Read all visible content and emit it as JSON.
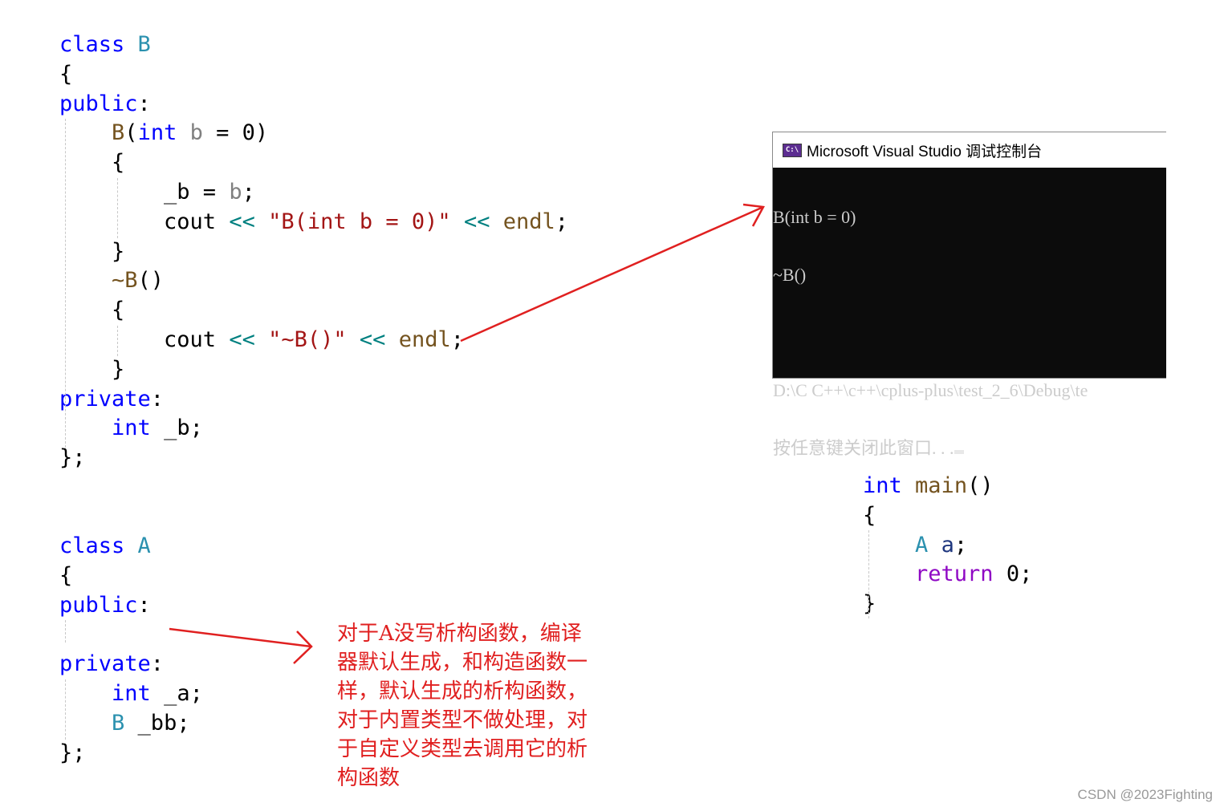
{
  "class_b": {
    "lines": [
      {
        "segments": [
          {
            "t": "class",
            "c": "kw"
          },
          {
            "t": " "
          },
          {
            "t": "B",
            "c": "ty"
          }
        ]
      },
      {
        "segments": [
          {
            "t": "{"
          }
        ]
      },
      {
        "segments": [
          {
            "t": "public",
            "c": "kw"
          },
          {
            "t": ":"
          }
        ]
      },
      {
        "segments": [
          {
            "t": "    "
          },
          {
            "t": "B",
            "c": "fn"
          },
          {
            "t": "("
          },
          {
            "t": "int",
            "c": "kw"
          },
          {
            "t": " "
          },
          {
            "t": "b",
            "c": "pm"
          },
          {
            "t": " = 0)"
          }
        ]
      },
      {
        "segments": [
          {
            "t": "    {"
          }
        ]
      },
      {
        "segments": [
          {
            "t": "        _b = "
          },
          {
            "t": "b",
            "c": "pm"
          },
          {
            "t": ";"
          }
        ]
      },
      {
        "segments": [
          {
            "t": "        cout "
          },
          {
            "t": "<<",
            "c": "op"
          },
          {
            "t": " "
          },
          {
            "t": "\"B(int b = 0)\"",
            "c": "st"
          },
          {
            "t": " "
          },
          {
            "t": "<<",
            "c": "op"
          },
          {
            "t": " "
          },
          {
            "t": "endl",
            "c": "fn"
          },
          {
            "t": ";"
          }
        ]
      },
      {
        "segments": [
          {
            "t": "    }"
          }
        ]
      },
      {
        "segments": [
          {
            "t": "    "
          },
          {
            "t": "~B",
            "c": "fn"
          },
          {
            "t": "()"
          }
        ]
      },
      {
        "segments": [
          {
            "t": "    {"
          }
        ]
      },
      {
        "segments": [
          {
            "t": "        cout "
          },
          {
            "t": "<<",
            "c": "op"
          },
          {
            "t": " "
          },
          {
            "t": "\"~B()\"",
            "c": "st"
          },
          {
            "t": " "
          },
          {
            "t": "<<",
            "c": "op"
          },
          {
            "t": " "
          },
          {
            "t": "endl",
            "c": "fn"
          },
          {
            "t": ";"
          }
        ]
      },
      {
        "segments": [
          {
            "t": "    }"
          }
        ]
      },
      {
        "segments": [
          {
            "t": "private",
            "c": "kw"
          },
          {
            "t": ":"
          }
        ]
      },
      {
        "segments": [
          {
            "t": "    "
          },
          {
            "t": "int",
            "c": "kw"
          },
          {
            "t": " _b;"
          }
        ]
      },
      {
        "segments": [
          {
            "t": "};"
          }
        ]
      }
    ]
  },
  "class_a": {
    "lines": [
      {
        "segments": [
          {
            "t": "class",
            "c": "kw"
          },
          {
            "t": " "
          },
          {
            "t": "A",
            "c": "ty"
          }
        ]
      },
      {
        "segments": [
          {
            "t": "{"
          }
        ]
      },
      {
        "segments": [
          {
            "t": "public",
            "c": "kw"
          },
          {
            "t": ":"
          }
        ]
      },
      {
        "segments": [
          {
            "t": ""
          }
        ]
      },
      {
        "segments": [
          {
            "t": "private",
            "c": "kw"
          },
          {
            "t": ":"
          }
        ]
      },
      {
        "segments": [
          {
            "t": "    "
          },
          {
            "t": "int",
            "c": "kw"
          },
          {
            "t": " _a;"
          }
        ]
      },
      {
        "segments": [
          {
            "t": "    "
          },
          {
            "t": "B",
            "c": "ty"
          },
          {
            "t": " _bb;"
          }
        ]
      },
      {
        "segments": [
          {
            "t": "};"
          }
        ]
      }
    ]
  },
  "main_func": {
    "lines": [
      {
        "segments": [
          {
            "t": "int",
            "c": "kw"
          },
          {
            "t": " "
          },
          {
            "t": "main",
            "c": "fn"
          },
          {
            "t": "()"
          }
        ]
      },
      {
        "segments": [
          {
            "t": "{"
          }
        ]
      },
      {
        "segments": [
          {
            "t": "    "
          },
          {
            "t": "A",
            "c": "ty"
          },
          {
            "t": " "
          },
          {
            "t": "a",
            "c": "var"
          },
          {
            "t": ";"
          }
        ]
      },
      {
        "segments": [
          {
            "t": "    "
          },
          {
            "t": "return",
            "c": "ret"
          },
          {
            "t": " 0;"
          }
        ]
      },
      {
        "segments": [
          {
            "t": "}"
          }
        ]
      }
    ]
  },
  "console": {
    "icon_label": "C:\\",
    "title": "Microsoft Visual Studio 调试控制台",
    "output_lines": [
      "B(int b = 0)",
      "~B()",
      "",
      "D:\\C C++\\c++\\cplus-plus\\test_2_6\\Debug\\te",
      "按任意键关闭此窗口. . ."
    ]
  },
  "annotation": {
    "text": "对于A没写析构函数，编译器默认生成，和构造函数一样，默认生成的析构函数，对于内置类型不做处理，对于自定义类型去调用它的析构函数",
    "color": "#e02020"
  },
  "watermark": "CSDN @2023Fighting"
}
